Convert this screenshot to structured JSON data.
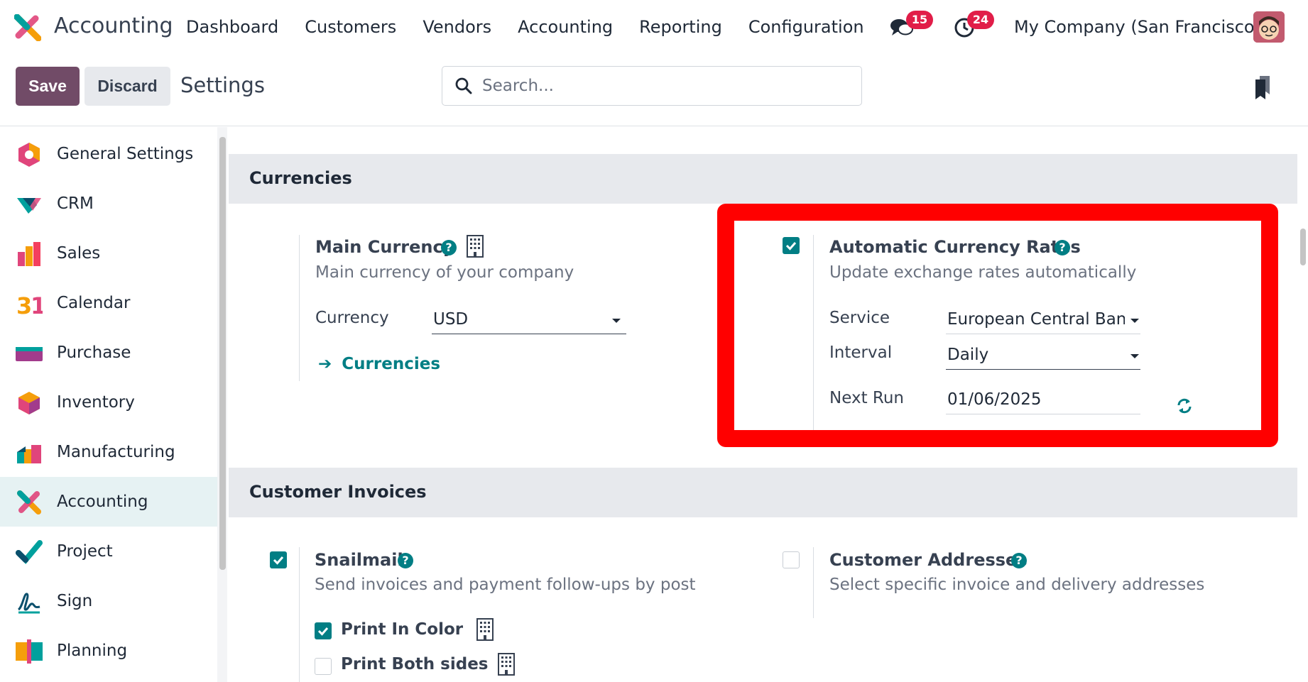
{
  "navbar": {
    "app_name": "Accounting",
    "menu": [
      "Dashboard",
      "Customers",
      "Vendors",
      "Accounting",
      "Reporting",
      "Configuration"
    ],
    "messages_badge": "15",
    "activities_badge": "24",
    "company": "My Company (San Francisco)"
  },
  "control": {
    "save_label": "Save",
    "discard_label": "Discard",
    "breadcrumb": "Settings",
    "search_placeholder": "Search..."
  },
  "sidebar": {
    "items": [
      {
        "label": "General Settings",
        "icon": "general-settings-icon"
      },
      {
        "label": "CRM",
        "icon": "crm-icon"
      },
      {
        "label": "Sales",
        "icon": "sales-icon"
      },
      {
        "label": "Calendar",
        "icon": "calendar-icon"
      },
      {
        "label": "Purchase",
        "icon": "purchase-icon"
      },
      {
        "label": "Inventory",
        "icon": "inventory-icon"
      },
      {
        "label": "Manufacturing",
        "icon": "manufacturing-icon"
      },
      {
        "label": "Accounting",
        "icon": "accounting-icon"
      },
      {
        "label": "Project",
        "icon": "project-icon"
      },
      {
        "label": "Sign",
        "icon": "sign-icon"
      },
      {
        "label": "Planning",
        "icon": "planning-icon"
      }
    ],
    "active_index": 7
  },
  "currencies": {
    "heading": "Currencies",
    "main_currency": {
      "title": "Main Currency",
      "desc": "Main currency of your company",
      "currency_label": "Currency",
      "currency_value": "USD",
      "link": "Currencies"
    },
    "auto_rates": {
      "checked": true,
      "title": "Automatic Currency Rates",
      "desc": "Update exchange rates automatically",
      "service_label": "Service",
      "service_value": "European Central Banl",
      "interval_label": "Interval",
      "interval_value": "Daily",
      "next_run_label": "Next Run",
      "next_run_value": "01/06/2025"
    }
  },
  "customer_invoices": {
    "heading": "Customer Invoices",
    "snailmail": {
      "checked": true,
      "title": "Snailmail",
      "desc": "Send invoices and payment follow-ups by post",
      "print_color_label": "Print In Color",
      "print_color_checked": true,
      "print_both_label": "Print Both sides",
      "print_both_checked": false
    },
    "customer_addresses": {
      "checked": false,
      "title": "Customer Addresses",
      "desc": "Select specific invoice and delivery addresses"
    }
  },
  "colors": {
    "brand": "#714b67",
    "accent": "#017e84",
    "badge": "#e11d48",
    "highlight": "#ff0000"
  }
}
